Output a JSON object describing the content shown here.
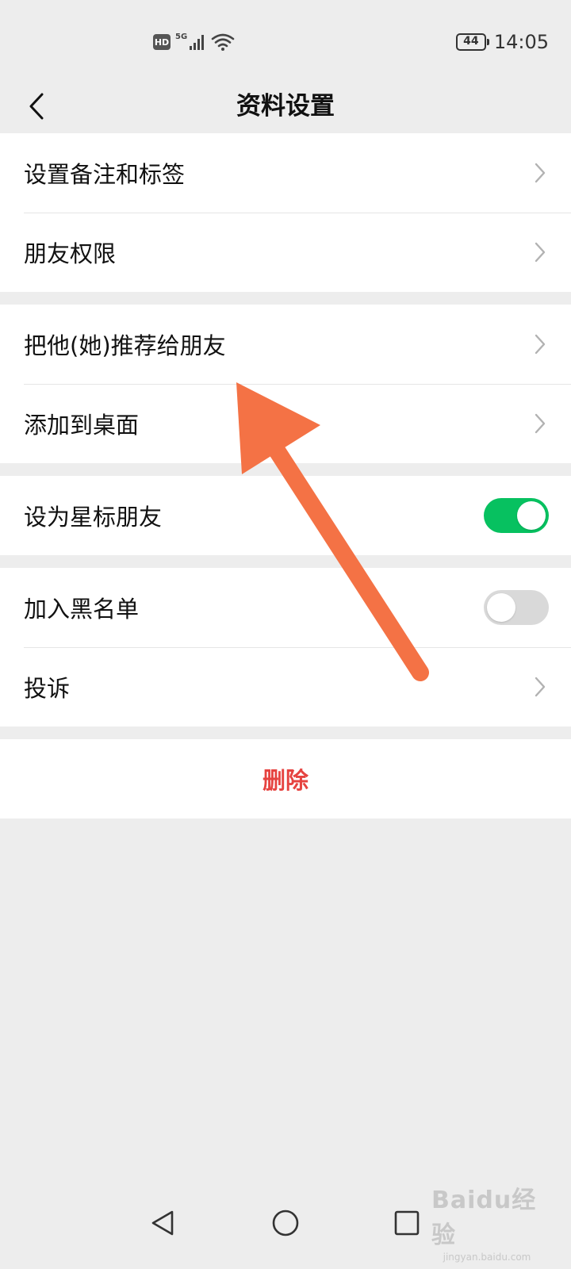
{
  "status_bar": {
    "hd_label": "HD",
    "network_label": "5G",
    "battery_level": "44",
    "time": "14:05",
    "icons": [
      "hd-icon",
      "signal-icon",
      "wifi-icon",
      "battery-icon"
    ]
  },
  "header": {
    "title": "资料设置",
    "back_icon": "chevron-left-icon"
  },
  "groups": [
    {
      "items": [
        {
          "label": "设置备注和标签",
          "control": "chevron"
        },
        {
          "label": "朋友权限",
          "control": "chevron"
        }
      ]
    },
    {
      "items": [
        {
          "label": "把他(她)推荐给朋友",
          "control": "chevron"
        },
        {
          "label": "添加到桌面",
          "control": "chevron"
        }
      ]
    },
    {
      "items": [
        {
          "label": "设为星标朋友",
          "control": "toggle",
          "on": true
        }
      ]
    },
    {
      "items": [
        {
          "label": "加入黑名单",
          "control": "toggle",
          "on": false
        },
        {
          "label": "投诉",
          "control": "chevron"
        }
      ]
    }
  ],
  "delete": {
    "label": "删除"
  },
  "colors": {
    "background": "#ededed",
    "toggle_on": "#07c160",
    "toggle_off": "#d9d9d9",
    "danger": "#e64340",
    "annotation_arrow": "#f47245"
  },
  "system_nav": {
    "icons": [
      "back-triangle-icon",
      "home-circle-icon",
      "recents-square-icon"
    ]
  },
  "watermark": {
    "main": "Baidu经验",
    "sub": "jingyan.baidu.com"
  }
}
